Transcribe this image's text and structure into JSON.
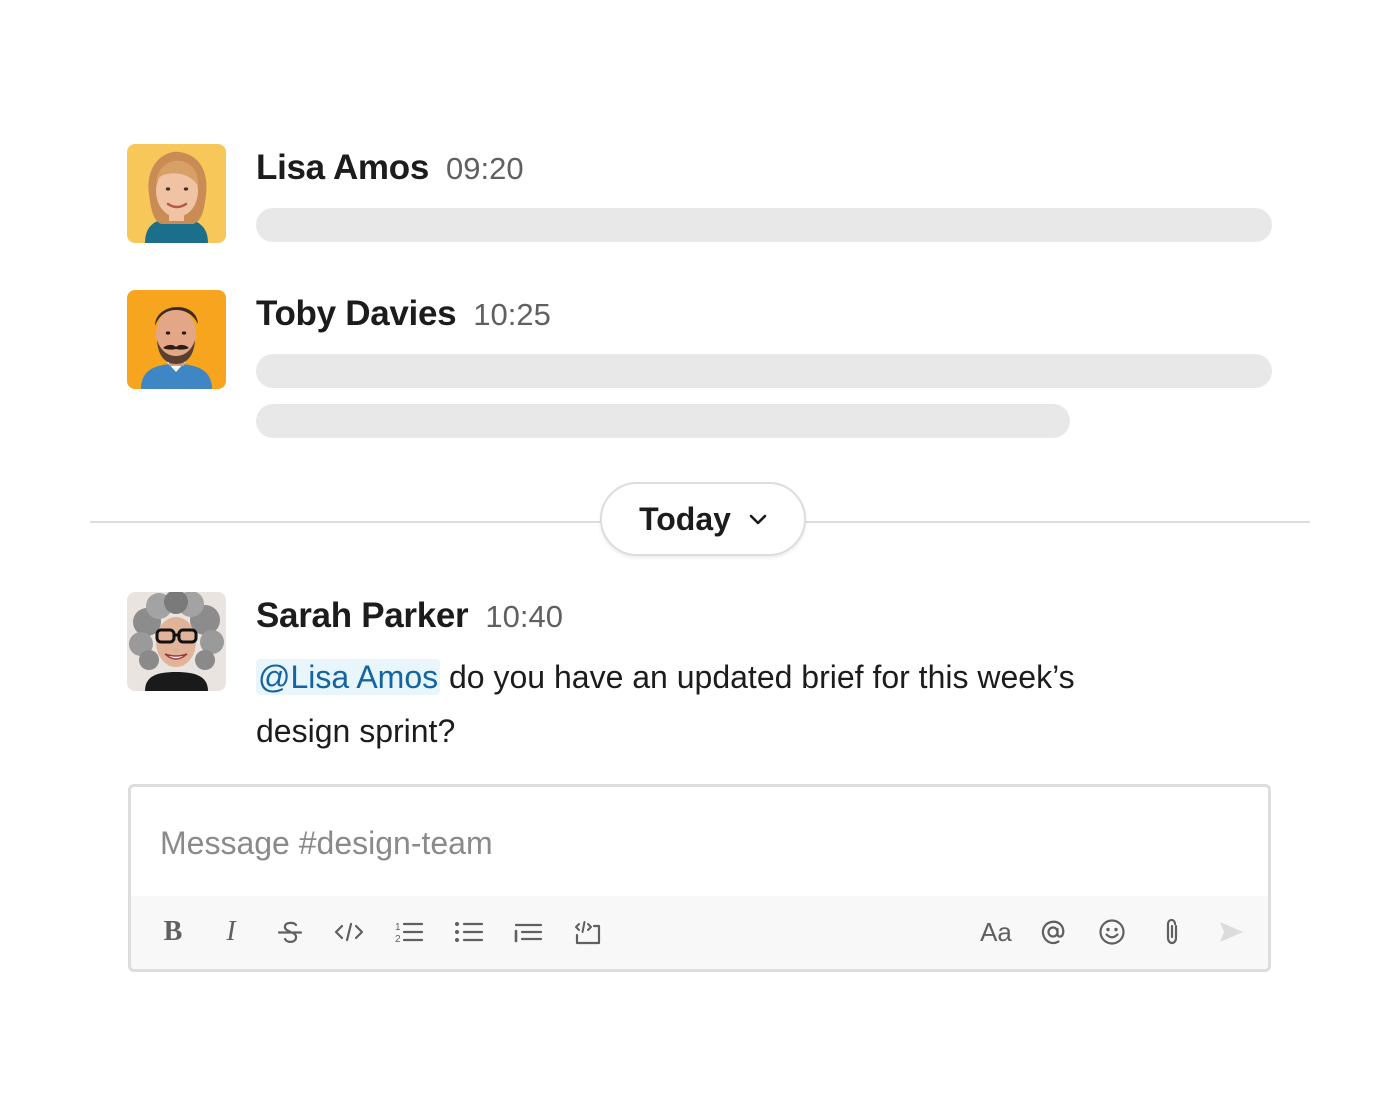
{
  "messages": [
    {
      "author": "Lisa Amos",
      "time": "09:20",
      "avatar": "lisa-amos-avatar"
    },
    {
      "author": "Toby Davies",
      "time": "10:25",
      "avatar": "toby-davies-avatar"
    }
  ],
  "divider": {
    "label": "Today"
  },
  "sarah": {
    "author": "Sarah Parker",
    "time": "10:40",
    "mention": "@Lisa Amos",
    "text": " do you have an updated brief for this week’s design sprint?"
  },
  "composer": {
    "placeholder": "Message #design-team",
    "value": "",
    "format_label": "Aa",
    "bold_label": "B",
    "italic_label": "I",
    "icons": [
      "bold-icon",
      "italic-icon",
      "strikethrough-icon",
      "code-icon",
      "numbered-list-icon",
      "bulleted-list-icon",
      "blockquote-icon",
      "code-block-icon",
      "text-format-icon",
      "mention-icon",
      "emoji-icon",
      "attachment-icon",
      "send-icon"
    ]
  },
  "colors": {
    "mention_text": "#1264a3",
    "mention_bg": "#e8f5fa",
    "skeleton": "#e8e8e8",
    "lisa_avatar_bg": "#f7c75a",
    "toby_avatar_bg": "#f7a51e"
  }
}
